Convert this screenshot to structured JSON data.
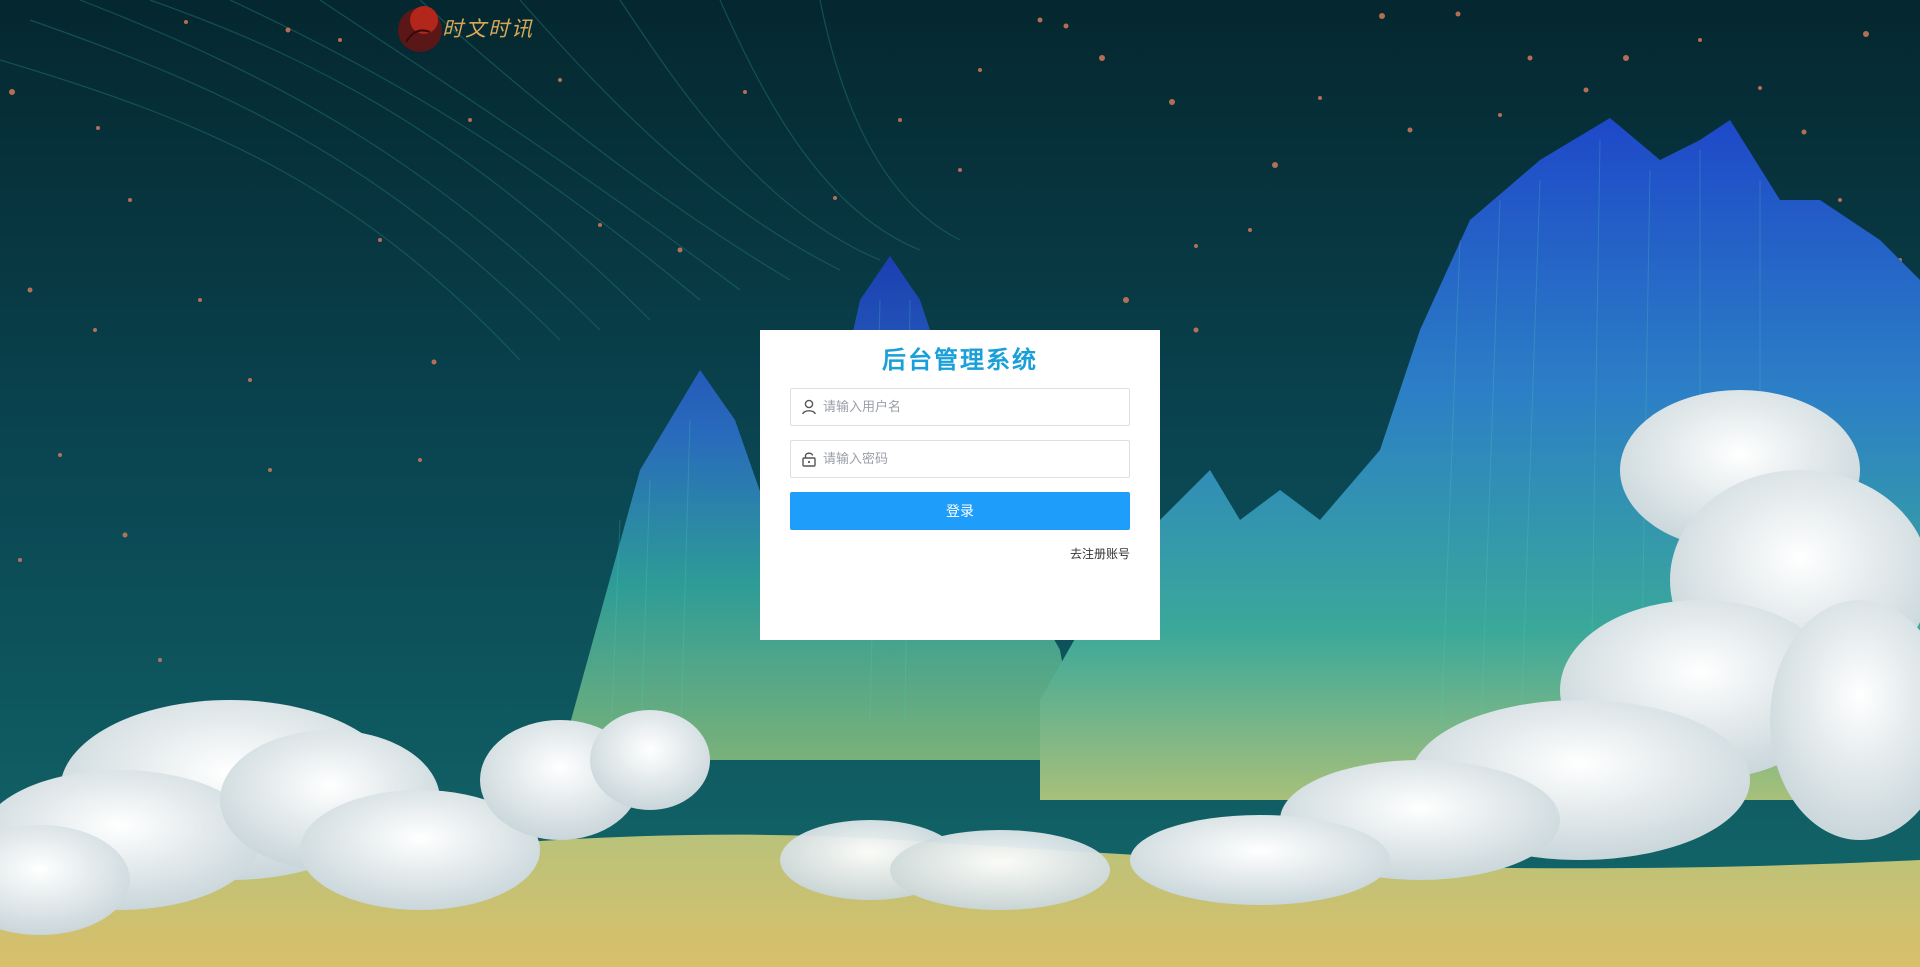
{
  "brand": {
    "logo_text": "时文时讯",
    "logo_color": "#d7a85a",
    "mark_color": "#8e1f1a"
  },
  "login": {
    "title": "后台管理系统",
    "username_placeholder": "请输入用户名",
    "password_placeholder": "请输入密码",
    "submit_label": "登录",
    "register_link": "去注册账号",
    "accent_color": "#1f9dfa",
    "title_color": "#1aa0d8",
    "icons": {
      "username": "user-icon",
      "password": "lock-icon"
    }
  }
}
